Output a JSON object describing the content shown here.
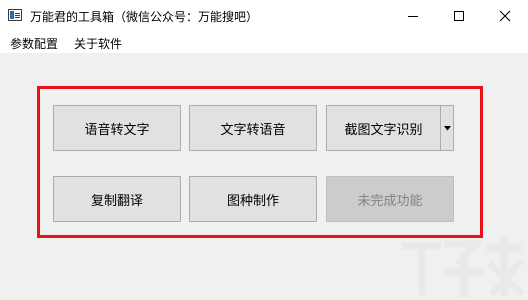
{
  "window": {
    "title": "万能君的工具箱（微信公众号：万能搜吧）",
    "icon": "app-window-icon"
  },
  "controls": {
    "minimize_icon": "minimize-icon",
    "maximize_icon": "maximize-icon",
    "close_icon": "close-icon"
  },
  "menu": {
    "items": [
      {
        "label": "参数配置"
      },
      {
        "label": "关于软件"
      }
    ]
  },
  "buttons": {
    "speech_to_text": "语音转文字",
    "text_to_speech": "文字转语音",
    "screenshot_ocr": "截图文字识别",
    "copy_translate": "复制翻译",
    "image_creation": "图种制作",
    "unfinished": "未完成功能"
  },
  "dropdown": {
    "icon": "chevron-down-icon"
  },
  "colors": {
    "highlight_border": "#e8141a",
    "button_face": "#e1e1e1",
    "disabled_face": "#cccccc",
    "disabled_text": "#838383"
  },
  "watermark": {
    "icon": "download-site-logo"
  }
}
